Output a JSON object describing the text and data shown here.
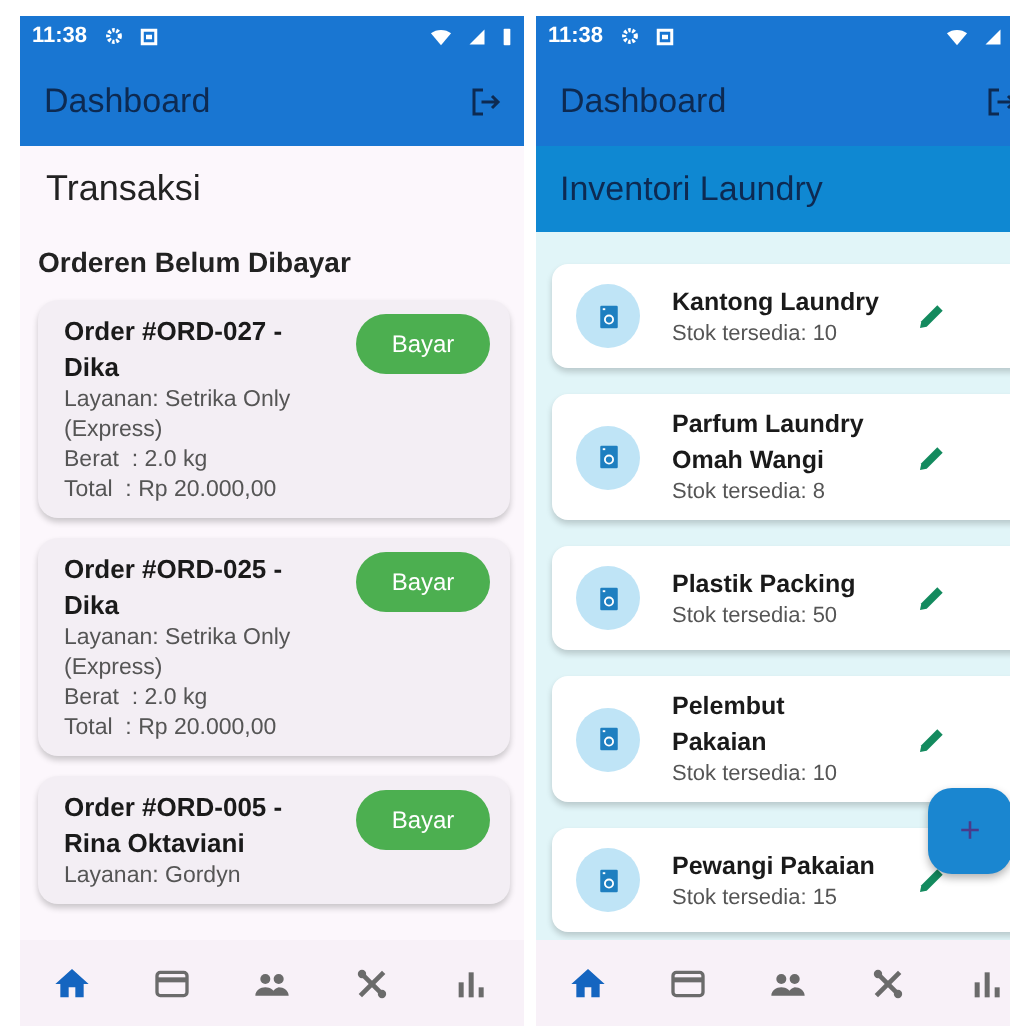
{
  "screens": [
    {
      "kind": "transactions",
      "status_bar": {
        "time": "11:38"
      },
      "app_bar": {
        "title": "Dashboard"
      },
      "page_title": "Transaksi",
      "section_title": "Orderen Belum Dibayar",
      "orders": [
        {
          "title": "Order #ORD-027 - Dika",
          "lines": [
            "Layanan: Setrika Only (Express)",
            "Berat  : 2.0 kg",
            "Total  : Rp 20.000,00"
          ],
          "button": "Bayar"
        },
        {
          "title": "Order #ORD-025 - Dika",
          "lines": [
            "Layanan: Setrika Only (Express)",
            "Berat  : 2.0 kg",
            "Total  : Rp 20.000,00"
          ],
          "button": "Bayar"
        },
        {
          "title": "Order #ORD-005 - Rina Oktaviani",
          "lines": [
            "Layanan: Gordyn"
          ],
          "button": "Bayar"
        }
      ],
      "nav": [
        {
          "kind": "home",
          "selected": true
        },
        {
          "kind": "card",
          "selected": false
        },
        {
          "kind": "people",
          "selected": false
        },
        {
          "kind": "tools",
          "selected": false
        },
        {
          "kind": "chart",
          "selected": false
        }
      ]
    },
    {
      "kind": "inventory",
      "status_bar": {
        "time": "11:38"
      },
      "app_bar": {
        "title": "Dashboard"
      },
      "header": "Inventori Laundry",
      "items": [
        {
          "name": "Kantong Laundry",
          "stock": "Stok tersedia: 10"
        },
        {
          "name": "Parfum Laundry Omah Wangi",
          "stock": "Stok tersedia: 8"
        },
        {
          "name": "Plastik Packing",
          "stock": "Stok tersedia: 50"
        },
        {
          "name": "Pelembut Pakaian",
          "stock": "Stok tersedia: 10"
        },
        {
          "name": "Pewangi Pakaian",
          "stock": "Stok tersedia: 15"
        }
      ],
      "fab": "+",
      "nav": [
        {
          "kind": "home",
          "selected": true
        },
        {
          "kind": "card",
          "selected": false
        },
        {
          "kind": "people",
          "selected": false
        },
        {
          "kind": "tools",
          "selected": false
        },
        {
          "kind": "chart",
          "selected": false
        }
      ]
    }
  ]
}
